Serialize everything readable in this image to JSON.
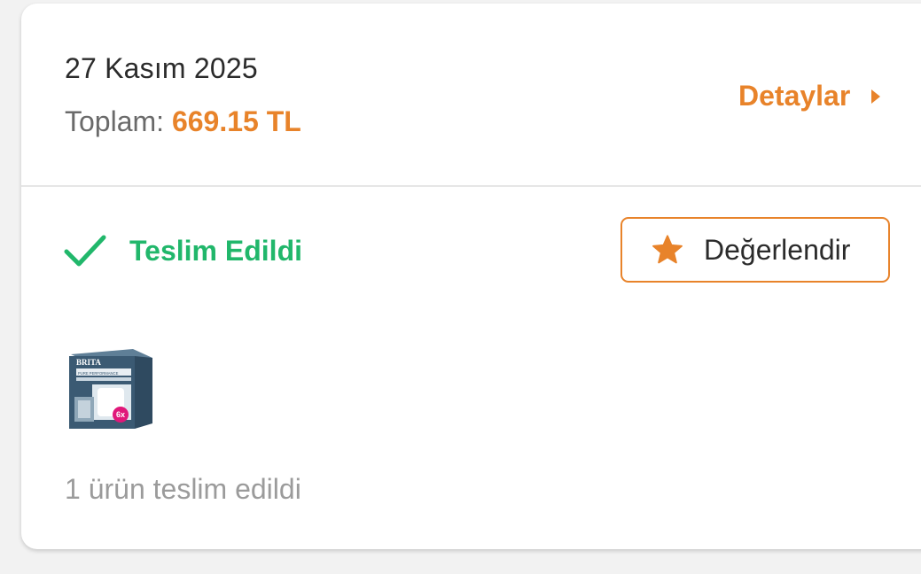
{
  "order": {
    "date": "27 Kasım 2025",
    "total_label": "Toplam:",
    "total_value": "669.15 TL",
    "details_label": "Detaylar",
    "status_text": "Teslim Edildi",
    "rate_label": "Değerlendir",
    "product_brand": "BRITA",
    "product_subtitle": "PURE PERFORMANCE",
    "product_badge": "6x",
    "delivered_summary": "1 ürün teslim edildi"
  },
  "icons": {
    "details": "caret-right-icon",
    "status": "check-icon",
    "rate": "star-icon"
  },
  "colors": {
    "accent": "#e8832a",
    "success": "#21b76b",
    "text_primary": "#2b2b2b",
    "text_secondary": "#6a6a6a",
    "text_muted": "#9b9b9b"
  }
}
